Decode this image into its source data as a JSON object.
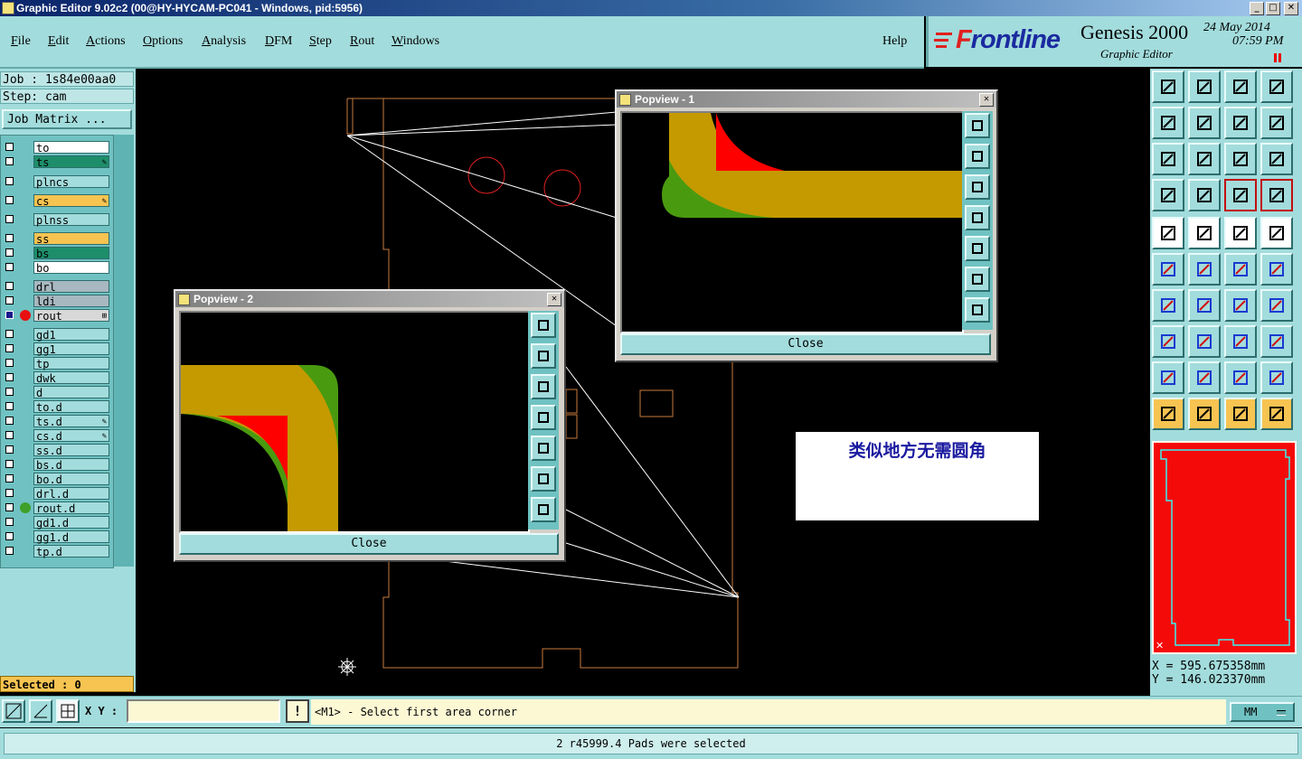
{
  "window": {
    "title": "Graphic Editor 9.02c2 (00@HY-HYCAM-PC041 - Windows, pid:5956)"
  },
  "menu": {
    "items": [
      {
        "label": "File",
        "hotkey": "F",
        "rest": "ile"
      },
      {
        "label": "Edit",
        "hotkey": "E",
        "rest": "dit"
      },
      {
        "label": "Actions",
        "hotkey": "A",
        "rest": "ctions"
      },
      {
        "label": "Options",
        "hotkey": "O",
        "rest": "ptions"
      },
      {
        "label": "Analysis",
        "hotkey": "A",
        "rest": "nalysis"
      },
      {
        "label": "DFM",
        "hotkey": "D",
        "rest": "FM"
      },
      {
        "label": "Step",
        "hotkey": "S",
        "rest": "tep"
      },
      {
        "label": "Rout",
        "hotkey": "R",
        "rest": "out"
      },
      {
        "label": "Windows",
        "hotkey": "W",
        "rest": "indows"
      }
    ],
    "help": "Help"
  },
  "brand": {
    "logo_prefix": "F",
    "logo_rest": "rontline",
    "product": "Genesis 2000",
    "subtitle": "Graphic Editor",
    "date": "24 May 2014",
    "time": "07:59 PM"
  },
  "job": {
    "job": "Job : 1s84e00aa0",
    "step": "Step: cam",
    "matrix_button": "Job Matrix ..."
  },
  "layers": [
    {
      "name": "to",
      "bg": "#ffffff",
      "mark": ""
    },
    {
      "name": "ts",
      "bg": "#1e8e6a",
      "mark": "✎"
    },
    {
      "name": "plncs",
      "bg": "#a3dcdc",
      "mark": ""
    },
    {
      "name": "cs",
      "bg": "#f7c452",
      "mark": "✎"
    },
    {
      "name": "plnss",
      "bg": "#a3dcdc",
      "mark": ""
    },
    {
      "name": "ss",
      "bg": "#f7c452",
      "mark": ""
    },
    {
      "name": "bs",
      "bg": "#1e8e6a",
      "mark": ""
    },
    {
      "name": "bo",
      "bg": "#ffffff",
      "mark": ""
    },
    {
      "name": "drl",
      "bg": "#a8b8c0",
      "mark": ""
    },
    {
      "name": "ldi",
      "bg": "#a8b8c0",
      "mark": ""
    },
    {
      "name": "rout",
      "bg": "#d8d8d8",
      "mark": "⊞",
      "dot": "#e81010",
      "chk_bg": "#1a1a8a"
    },
    {
      "name": "gd1",
      "bg": "#a3dcdc",
      "mark": ""
    },
    {
      "name": "gg1",
      "bg": "#a3dcdc",
      "mark": ""
    },
    {
      "name": "tp",
      "bg": "#a3dcdc",
      "mark": ""
    },
    {
      "name": "dwk",
      "bg": "#a3dcdc",
      "mark": ""
    },
    {
      "name": "d",
      "bg": "#a3dcdc",
      "mark": ""
    },
    {
      "name": "to.d",
      "bg": "#a3dcdc",
      "mark": ""
    },
    {
      "name": "ts.d",
      "bg": "#a3dcdc",
      "mark": "✎"
    },
    {
      "name": "cs.d",
      "bg": "#a3dcdc",
      "mark": "✎"
    },
    {
      "name": "ss.d",
      "bg": "#a3dcdc",
      "mark": ""
    },
    {
      "name": "bs.d",
      "bg": "#a3dcdc",
      "mark": ""
    },
    {
      "name": "bo.d",
      "bg": "#a3dcdc",
      "mark": ""
    },
    {
      "name": "drl.d",
      "bg": "#a3dcdc",
      "mark": ""
    },
    {
      "name": "rout.d",
      "bg": "#a3dcdc",
      "mark": "",
      "dot": "#3ea02a"
    },
    {
      "name": "gd1.d",
      "bg": "#a3dcdc",
      "mark": ""
    },
    {
      "name": "gg1.d",
      "bg": "#a3dcdc",
      "mark": ""
    },
    {
      "name": "tp.d",
      "bg": "#a3dcdc",
      "mark": ""
    }
  ],
  "selected_text": "Selected : 0",
  "popview1": {
    "title": "Popview - 1",
    "close": "Close"
  },
  "popview2": {
    "title": "Popview - 2",
    "close": "Close"
  },
  "note": "类似地方无需圆角",
  "coords": {
    "x": "X  =  595.675358mm",
    "y": "Y  =  146.023370mm"
  },
  "bottom": {
    "xy_label": "X Y :",
    "xy_value": "",
    "prompt": "<M1> - Select first area corner",
    "units": "MM",
    "status": "2 r45999.4 Pads were selected"
  },
  "colors": {
    "panel": "#a3dcdc",
    "pad_gold": "#c49a00",
    "pad_green": "#4a9a10",
    "pad_red": "#ff0000",
    "outline": "#c87a3c"
  }
}
